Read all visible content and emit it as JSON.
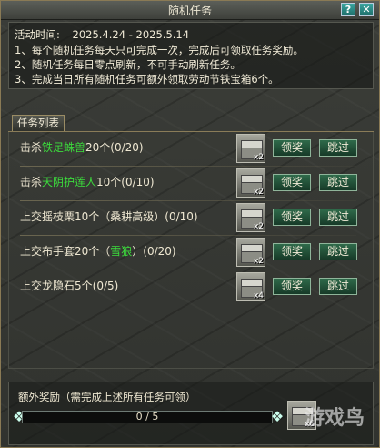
{
  "window": {
    "title": "随机任务",
    "help_icon": "?",
    "close_icon": "✕"
  },
  "info": {
    "date_label": "活动时间:",
    "date_range": "2025.4.24 - 2025.5.14",
    "rules": [
      "1、每个随机任务每天只可完成一次，完成后可领取任务奖励。",
      "2、随机任务每日零点刷新，不可手动刷新任务。",
      "3、完成当日所有随机任务可额外领取劳动节铁宝箱6个。"
    ]
  },
  "tab": {
    "label": "任务列表"
  },
  "tasks": [
    {
      "pre": "击杀",
      "hl": "铁足蛛兽",
      "post": "20个(0/20)",
      "qty": "x2",
      "claim": "领奖",
      "skip": "跳过"
    },
    {
      "pre": "击杀",
      "hl": "天阴护莲人",
      "post": "10个(0/10)",
      "qty": "x2",
      "claim": "领奖",
      "skip": "跳过"
    },
    {
      "pre": "上交摇枝栗10个（桑耕高级）(0/10)",
      "hl": "",
      "post": "",
      "qty": "x2",
      "claim": "领奖",
      "skip": "跳过"
    },
    {
      "pre": "上交布手套20个（",
      "hl": "雪狼",
      "post": "）(0/20)",
      "qty": "x2",
      "claim": "领奖",
      "skip": "跳过"
    },
    {
      "pre": "上交龙隐石5个(0/5)",
      "hl": "",
      "post": "",
      "qty": "x4",
      "claim": "领奖",
      "skip": "跳过"
    }
  ],
  "extra": {
    "title": "额外奖励（需完成上述所有任务可领）",
    "progress_text": "0 / 5",
    "progress": 0,
    "qty": "x6"
  },
  "watermark": "游戏鸟",
  "colors": {
    "highlight": "#3cdc3c",
    "button": "#2f6a4a",
    "bar": "#2ea59a"
  }
}
